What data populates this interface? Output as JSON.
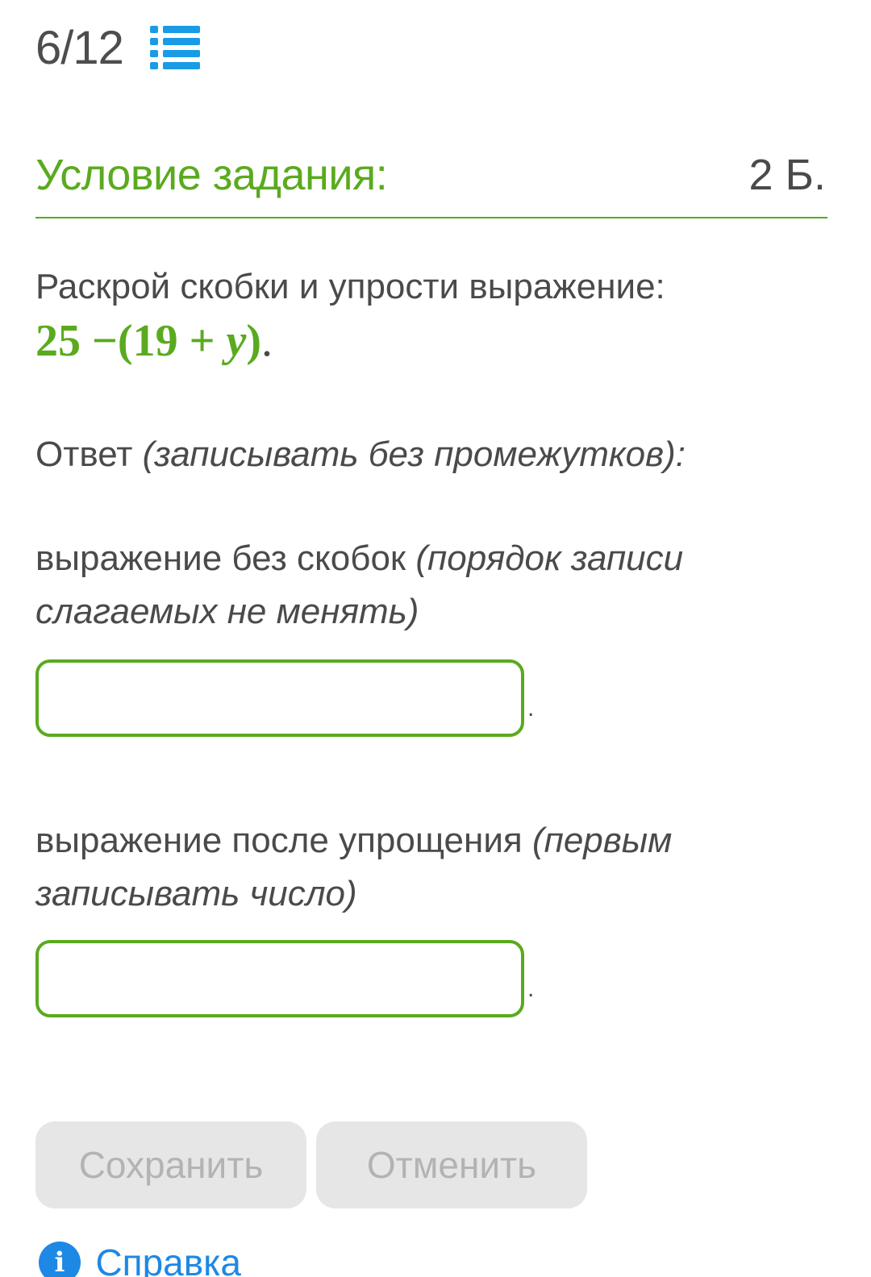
{
  "header": {
    "progress": "6/12",
    "list_icon": "list-icon"
  },
  "condition": {
    "title": "Условие задания:",
    "points": "2 Б.",
    "accent_color": "#5aaa1e"
  },
  "task": {
    "text": "Раскрой скобки и упрости выражение:",
    "expr_number": "25",
    "expr_minus": "−",
    "expr_open": "(19",
    "expr_plus": "+",
    "expr_var": "y",
    "expr_close": ")",
    "expr_dot": "."
  },
  "answer": {
    "label": "Ответ",
    "hint": "(записывать без промежутков):"
  },
  "questions": [
    {
      "label": "выражение без скобок",
      "hint": "(порядок записи слагаемых не менять)",
      "value": "",
      "suffix": "."
    },
    {
      "label": "выражение после упрощения",
      "hint": "(первым записывать число)",
      "value": "",
      "suffix": "."
    }
  ],
  "buttons": {
    "save": "Сохранить",
    "cancel": "Отменить"
  },
  "help": {
    "icon": "info-icon",
    "icon_glyph": "i",
    "label": "Справка",
    "color": "#1e88e5"
  }
}
